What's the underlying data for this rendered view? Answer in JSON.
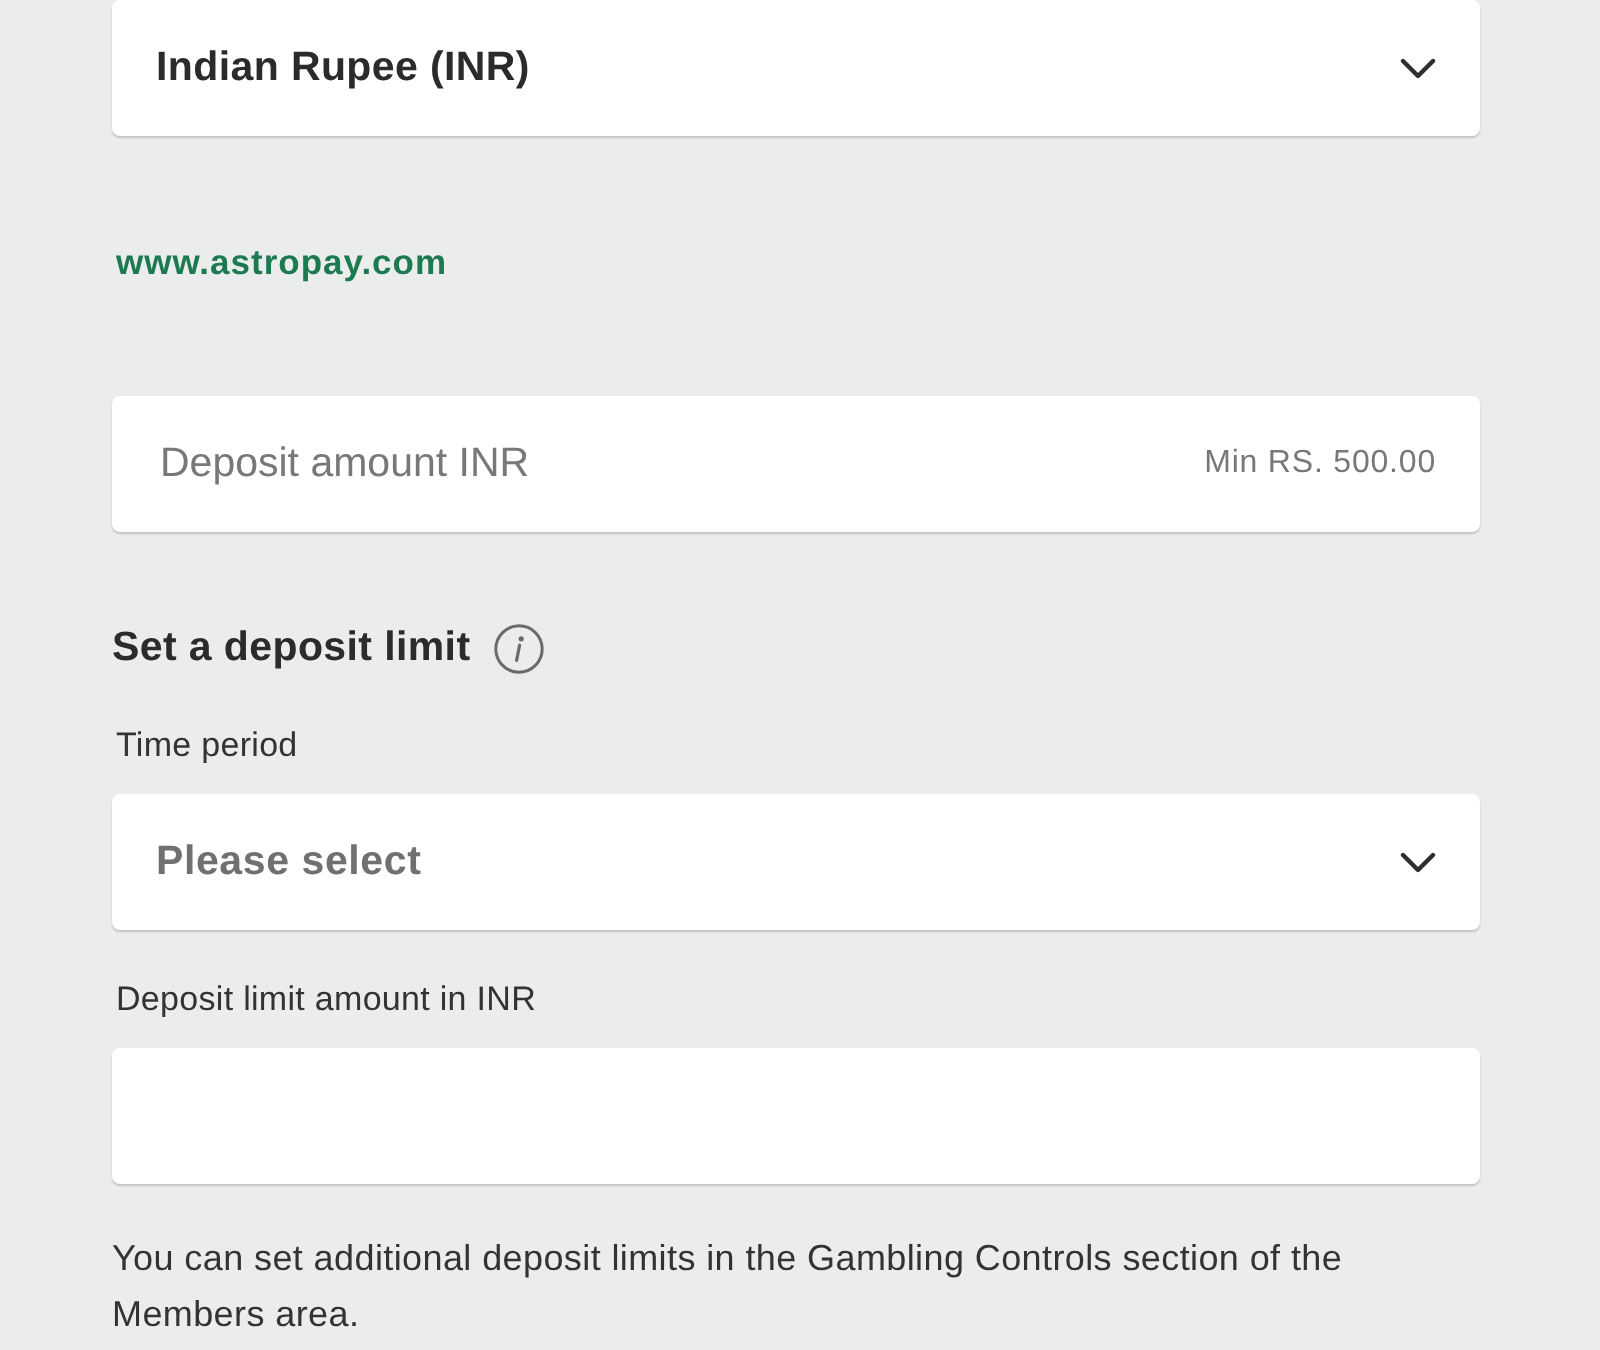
{
  "currency_select": {
    "value": "Indian Rupee (INR)"
  },
  "link": "www.astropay.com",
  "deposit_amount": {
    "placeholder": "Deposit amount INR",
    "hint": "Min RS. 500.00"
  },
  "deposit_limit": {
    "title": "Set a deposit limit",
    "time_period": {
      "label": "Time period",
      "placeholder": "Please select"
    },
    "amount": {
      "label": "Deposit limit amount in INR"
    }
  },
  "note": "You can set additional deposit limits in the Gambling Controls section of the Members area."
}
